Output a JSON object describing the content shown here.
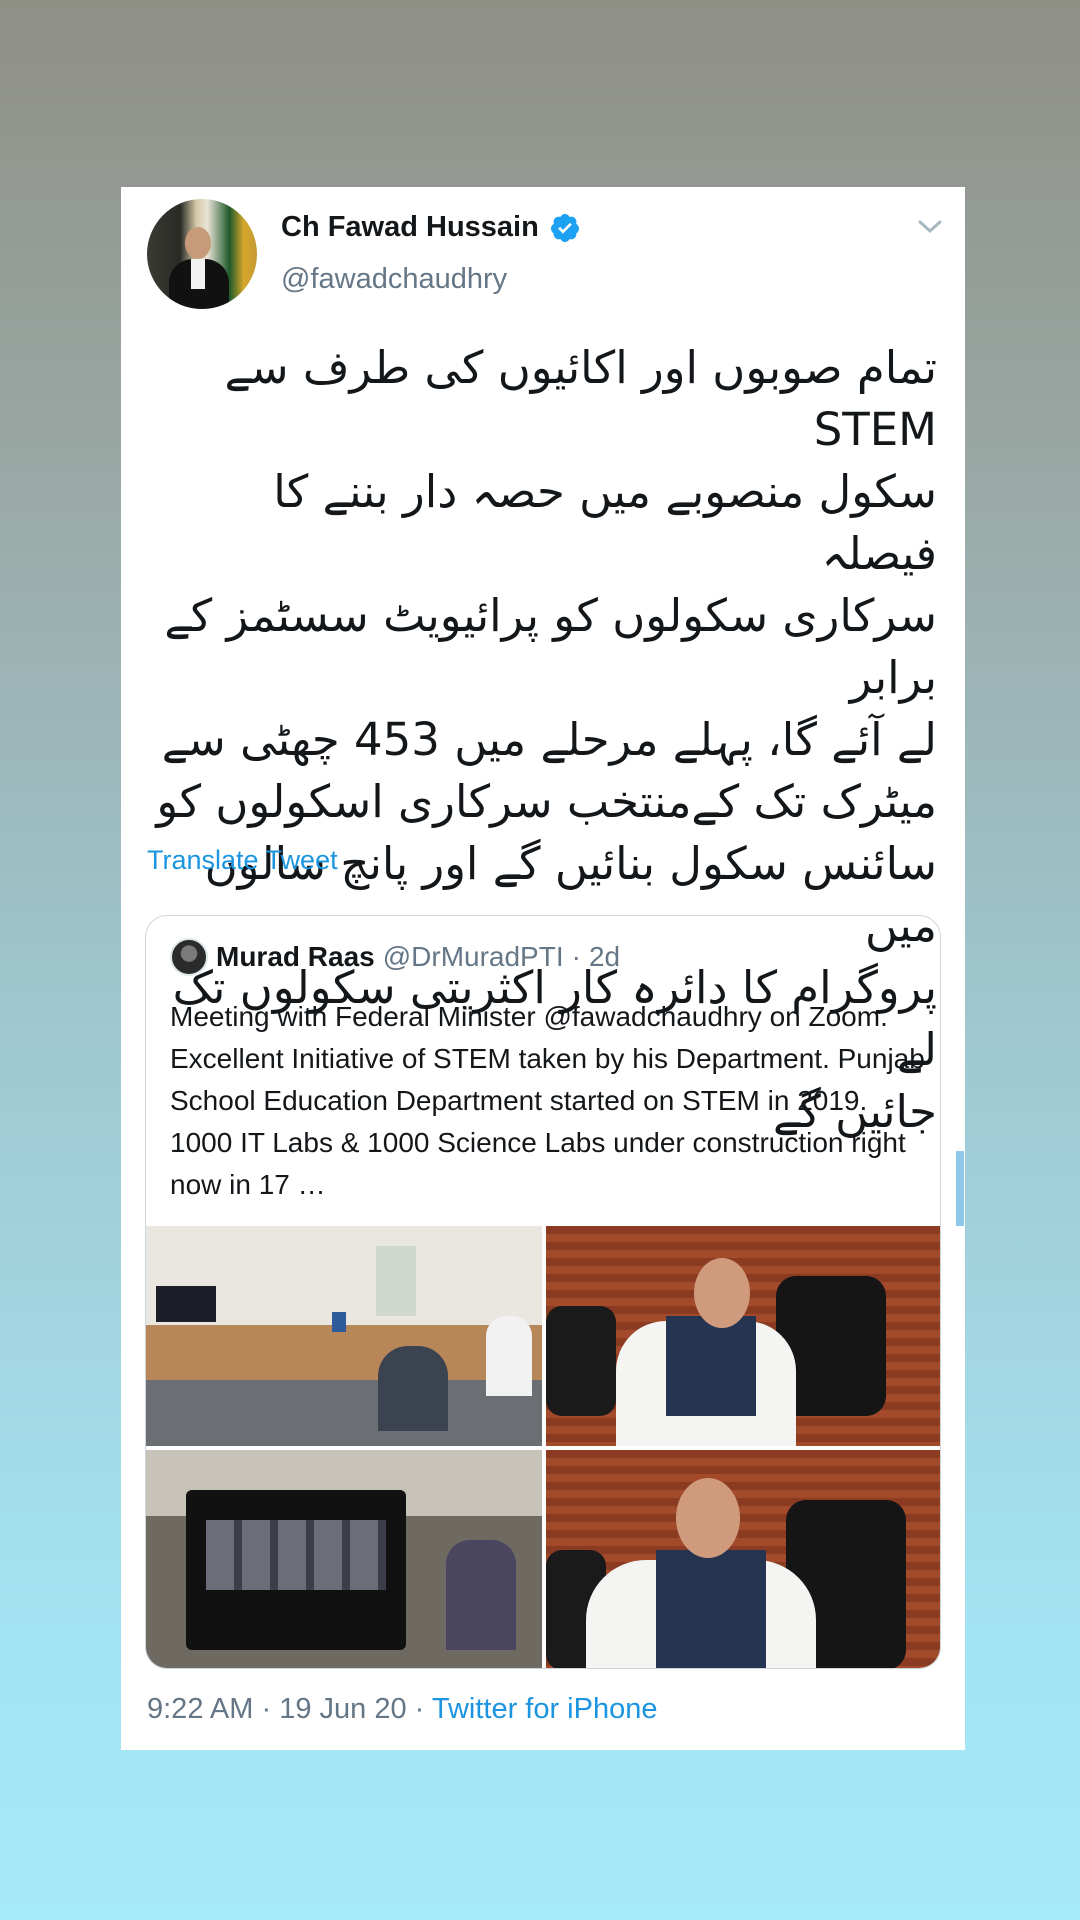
{
  "tweet": {
    "author_name": "Ch Fawad Hussain",
    "author_handle": "@fawadchaudhry",
    "text_lines": [
      "تمام صوبوں اور اکائیوں کی طرف سے STEM",
      "سکول منصوبے میں حصہ دار بننے کا فیصلہ",
      "سرکاری سکولوں کو پرائیویٹ سسٹمز کے برابر",
      "لے آئے گا، پہلے مرحلے میں 453 چھٹی سے",
      "میٹرک تک کےمنتخب سرکاری اسکولوں کو",
      "سائنس سکول بنائیں گے اور پانچ سالوں میں",
      "پروگرام کا دائرہ کار اکثریتی سکولوں تک لے",
      "جائیں گے"
    ],
    "translate_label": "Translate Tweet",
    "time": "9:22 AM",
    "date": "19 Jun 20",
    "source": "Twitter for iPhone",
    "separator": " · "
  },
  "quoted": {
    "author_name": "Murad Raas",
    "author_handle": "@DrMuradPTI",
    "age": "2d",
    "text": "Meeting with Federal Minister @fawadchaudhry on Zoom. Excellent Initiative of STEM taken by his Department. Punjab School Education Department started on STEM in 2019. 1000 IT Labs & 1000 Science Labs under construction right now in 17 …"
  },
  "icons": {
    "verified": "verified-badge-icon",
    "caret": "chevron-down-icon"
  },
  "colors": {
    "link": "#1b95e0",
    "secondary_text": "#657786",
    "primary_text": "#14171a"
  }
}
